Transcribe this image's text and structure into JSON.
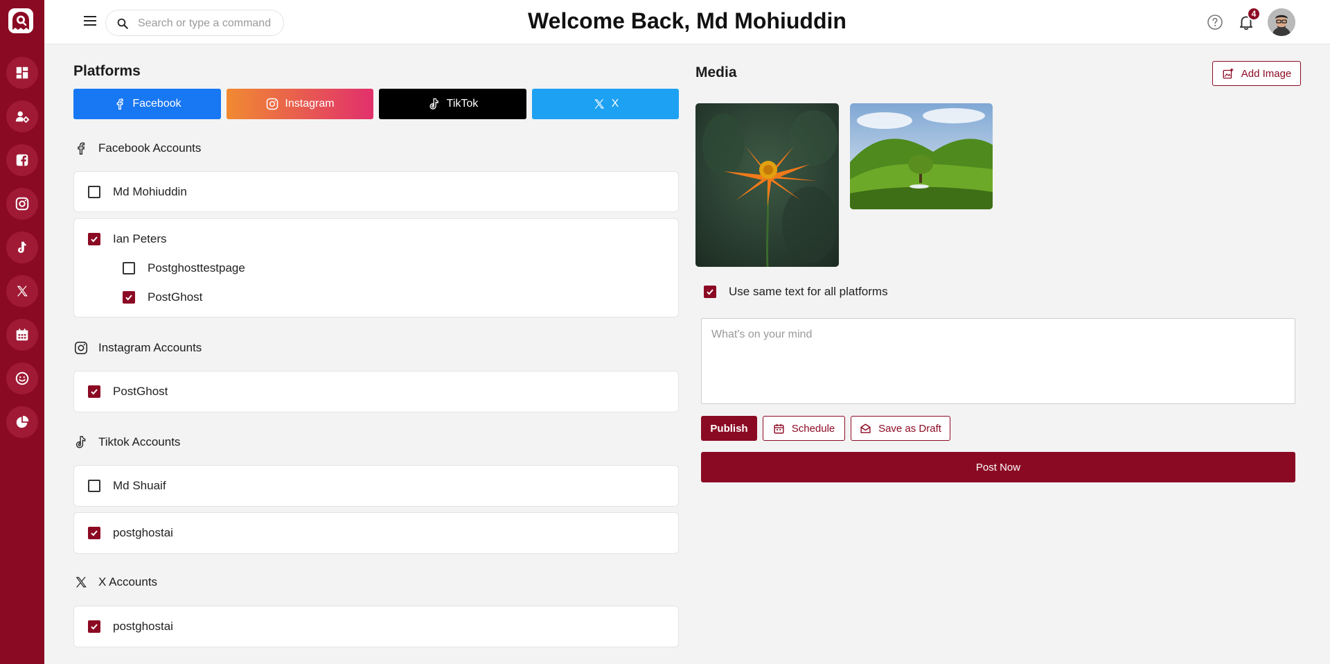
{
  "search": {
    "placeholder": "Search or type a command"
  },
  "header": {
    "title": "Welcome Back, Md Mohiuddin",
    "notification_count": "4"
  },
  "sidebar": {
    "items": [
      {
        "name": "dashboard"
      },
      {
        "name": "user-settings"
      },
      {
        "name": "facebook"
      },
      {
        "name": "instagram"
      },
      {
        "name": "tiktok"
      },
      {
        "name": "x"
      },
      {
        "name": "calendar"
      },
      {
        "name": "smiley"
      },
      {
        "name": "analytics"
      }
    ]
  },
  "platforms": {
    "title": "Platforms",
    "buttons": [
      {
        "label": "Facebook",
        "color": "#1877f2",
        "icon": "facebook-icon"
      },
      {
        "label": "Instagram",
        "color_from": "#f08a32",
        "color_to": "#e1306c",
        "icon": "instagram-icon"
      },
      {
        "label": "TikTok",
        "color": "#000000",
        "icon": "tiktok-icon"
      },
      {
        "label": "X",
        "color": "#1da1f2",
        "icon": "x-icon"
      }
    ]
  },
  "accounts": {
    "facebook": {
      "title": "Facebook Accounts",
      "items": [
        {
          "name": "Md Mohiuddin",
          "checked": false
        },
        {
          "name": "Ian Peters",
          "checked": true,
          "pages": [
            {
              "name": "Postghosttestpage",
              "checked": false
            },
            {
              "name": "PostGhost",
              "checked": true
            }
          ]
        }
      ]
    },
    "instagram": {
      "title": "Instagram Accounts",
      "items": [
        {
          "name": "PostGhost",
          "checked": true
        }
      ]
    },
    "tiktok": {
      "title": "Tiktok Accounts",
      "items": [
        {
          "name": "Md Shuaif",
          "checked": false
        },
        {
          "name": "postghostai",
          "checked": true
        }
      ]
    },
    "x": {
      "title": "X Accounts",
      "items": [
        {
          "name": "postghostai",
          "checked": true
        }
      ]
    }
  },
  "media": {
    "title": "Media",
    "add_image_label": "Add Image",
    "images": [
      {
        "subject": "orange flower"
      },
      {
        "subject": "green hills landscape"
      }
    ]
  },
  "composer": {
    "same_text_label": "Use same text for all platforms",
    "same_text_checked": true,
    "placeholder": "What's on your mind",
    "text": "",
    "publish_label": "Publish",
    "schedule_label": "Schedule",
    "draft_label": "Save as Draft",
    "post_now_label": "Post Now"
  },
  "colors": {
    "brand": "#8b0a23",
    "background": "#f3f3f3"
  }
}
